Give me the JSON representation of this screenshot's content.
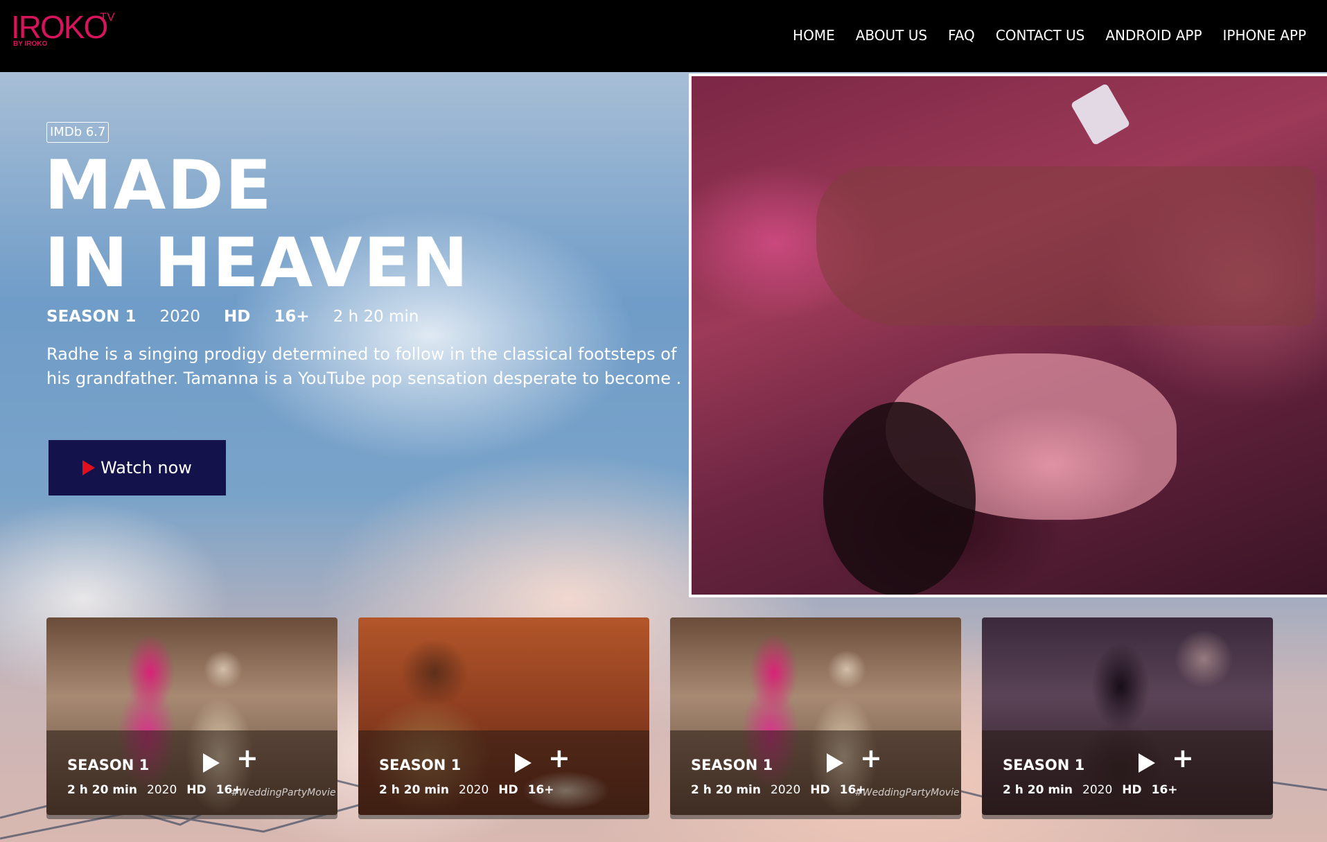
{
  "header": {
    "logo_main": "IROKO",
    "logo_tv": "TV",
    "logo_sub": "BY IROKO",
    "nav": [
      "HOME",
      "ABOUT US",
      "FAQ",
      "CONTACT US",
      "ANDROID APP",
      "IPHONE APP"
    ]
  },
  "hero": {
    "imdb": "IMDb 6.7",
    "title_line1": "MADE",
    "title_line2": "IN HEAVEN",
    "meta": {
      "season": "SEASON 1",
      "year": "2020",
      "quality": "HD",
      "rating": "16+",
      "duration": "2 h 20 min"
    },
    "description": "Radhe is a singing prodigy determined to follow in the classical footsteps of his grandfather. Tamanna is a YouTube pop sensation desperate to become .",
    "watch_label": "Watch now"
  },
  "cards": [
    {
      "season": "SEASON 1",
      "duration": "2 h 20 min",
      "year": "2020",
      "quality": "HD",
      "rating": "16+",
      "hashtag": "#WeddingPartyMovie",
      "image": "wedding"
    },
    {
      "season": "SEASON 1",
      "duration": "2 h 20 min",
      "year": "2020",
      "quality": "HD",
      "rating": "16+",
      "hashtag": "",
      "image": "couch"
    },
    {
      "season": "SEASON 1",
      "duration": "2 h 20 min",
      "year": "2020",
      "quality": "HD",
      "rating": "16+",
      "hashtag": "#WeddingPartyMovie",
      "image": "wedding"
    },
    {
      "season": "SEASON 1",
      "duration": "2 h 20 min",
      "year": "2020",
      "quality": "HD",
      "rating": "16+",
      "hashtag": "",
      "image": "theater"
    }
  ],
  "colors": {
    "brand": "#d6145b",
    "watch_button": "#13124a",
    "play_icon": "#e0101e"
  }
}
